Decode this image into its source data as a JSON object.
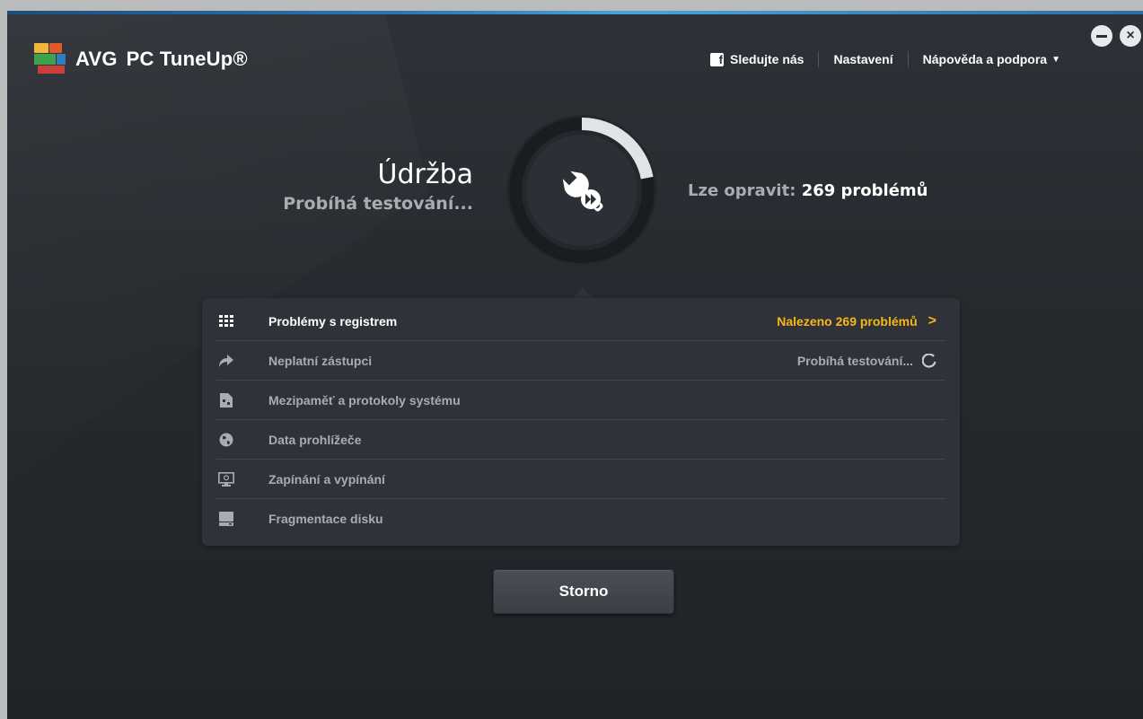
{
  "app": {
    "brand": "AVG",
    "product": "PC TuneUp®"
  },
  "topnav": {
    "follow_label": "Sledujte nás",
    "settings_label": "Nastavení",
    "help_label": "Nápověda a podpora",
    "help_caret": "▼",
    "facebook_glyph": "f"
  },
  "window_controls": {
    "close_glyph": "×"
  },
  "hero": {
    "title": "Údržba",
    "subtitle": "Probíhá testování...",
    "fixable_label": "Lze opravit:",
    "fixable_count": "269 problémů",
    "progress": 0.22
  },
  "tasks": [
    {
      "label": "Problémy s registrem",
      "status": "Nalezeno 269 problémů",
      "status_suffix": ">",
      "icon": "registry-grid-icon"
    },
    {
      "label": "Neplatní zástupci",
      "status": "Probíhá testování...",
      "icon": "shortcut-arrow-icon"
    },
    {
      "label": "Mezipaměť a protokoly systému",
      "status": "",
      "icon": "cache-file-icon"
    },
    {
      "label": "Data prohlížeče",
      "status": "",
      "icon": "globe-icon"
    },
    {
      "label": "Zapínání a vypínání",
      "status": "",
      "icon": "monitor-power-icon"
    },
    {
      "label": "Fragmentace disku",
      "status": "",
      "icon": "disk-drive-icon"
    }
  ],
  "actions": {
    "cancel_label": "Storno"
  },
  "colors": {
    "accent_found": "#f6b817",
    "background": "#26292e",
    "panel": "#2f3238"
  }
}
